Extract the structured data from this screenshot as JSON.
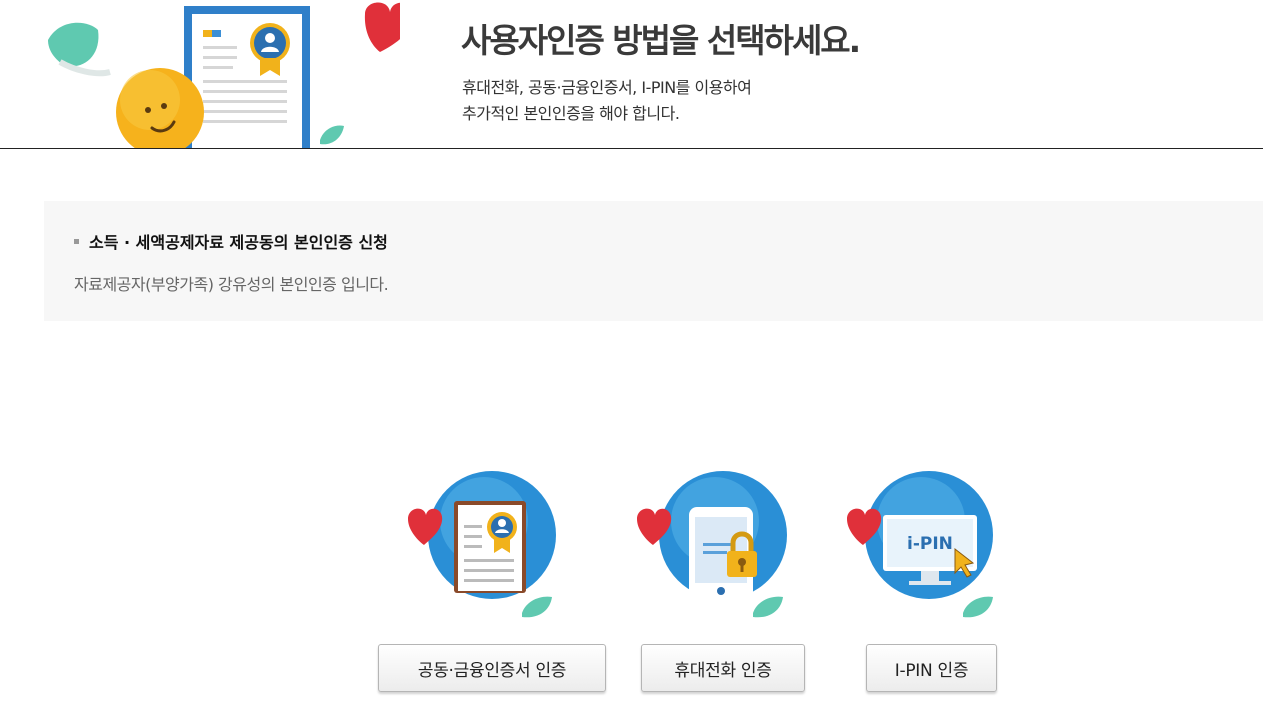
{
  "header": {
    "title": "사용자인증 방법을 선택하세요.",
    "desc_line1": "휴대전화, 공동·금융인증서, I-PIN를 이용하여",
    "desc_line2": "추가적인 본인인증을 해야 합니다."
  },
  "notice": {
    "title": "소득 · 세액공제자료 제공동의 본인인증 신청",
    "desc": "자료제공자(부양가족) 강유성의 본인인증 입니다."
  },
  "auth_options": {
    "certificate": {
      "label": "공동·금융인증서 인증",
      "icon": "certificate-icon"
    },
    "mobile": {
      "label": "휴대전화 인증",
      "icon": "mobile-lock-icon"
    },
    "ipin": {
      "label": "I-PIN 인증",
      "icon": "ipin-monitor-icon",
      "screen_text": "i-PIN"
    }
  },
  "colors": {
    "heart": "#e0303a",
    "circle_blue": "#2a8fd6",
    "leaf_green": "#5fc9b0",
    "smiley_yellow": "#f6b21c"
  }
}
